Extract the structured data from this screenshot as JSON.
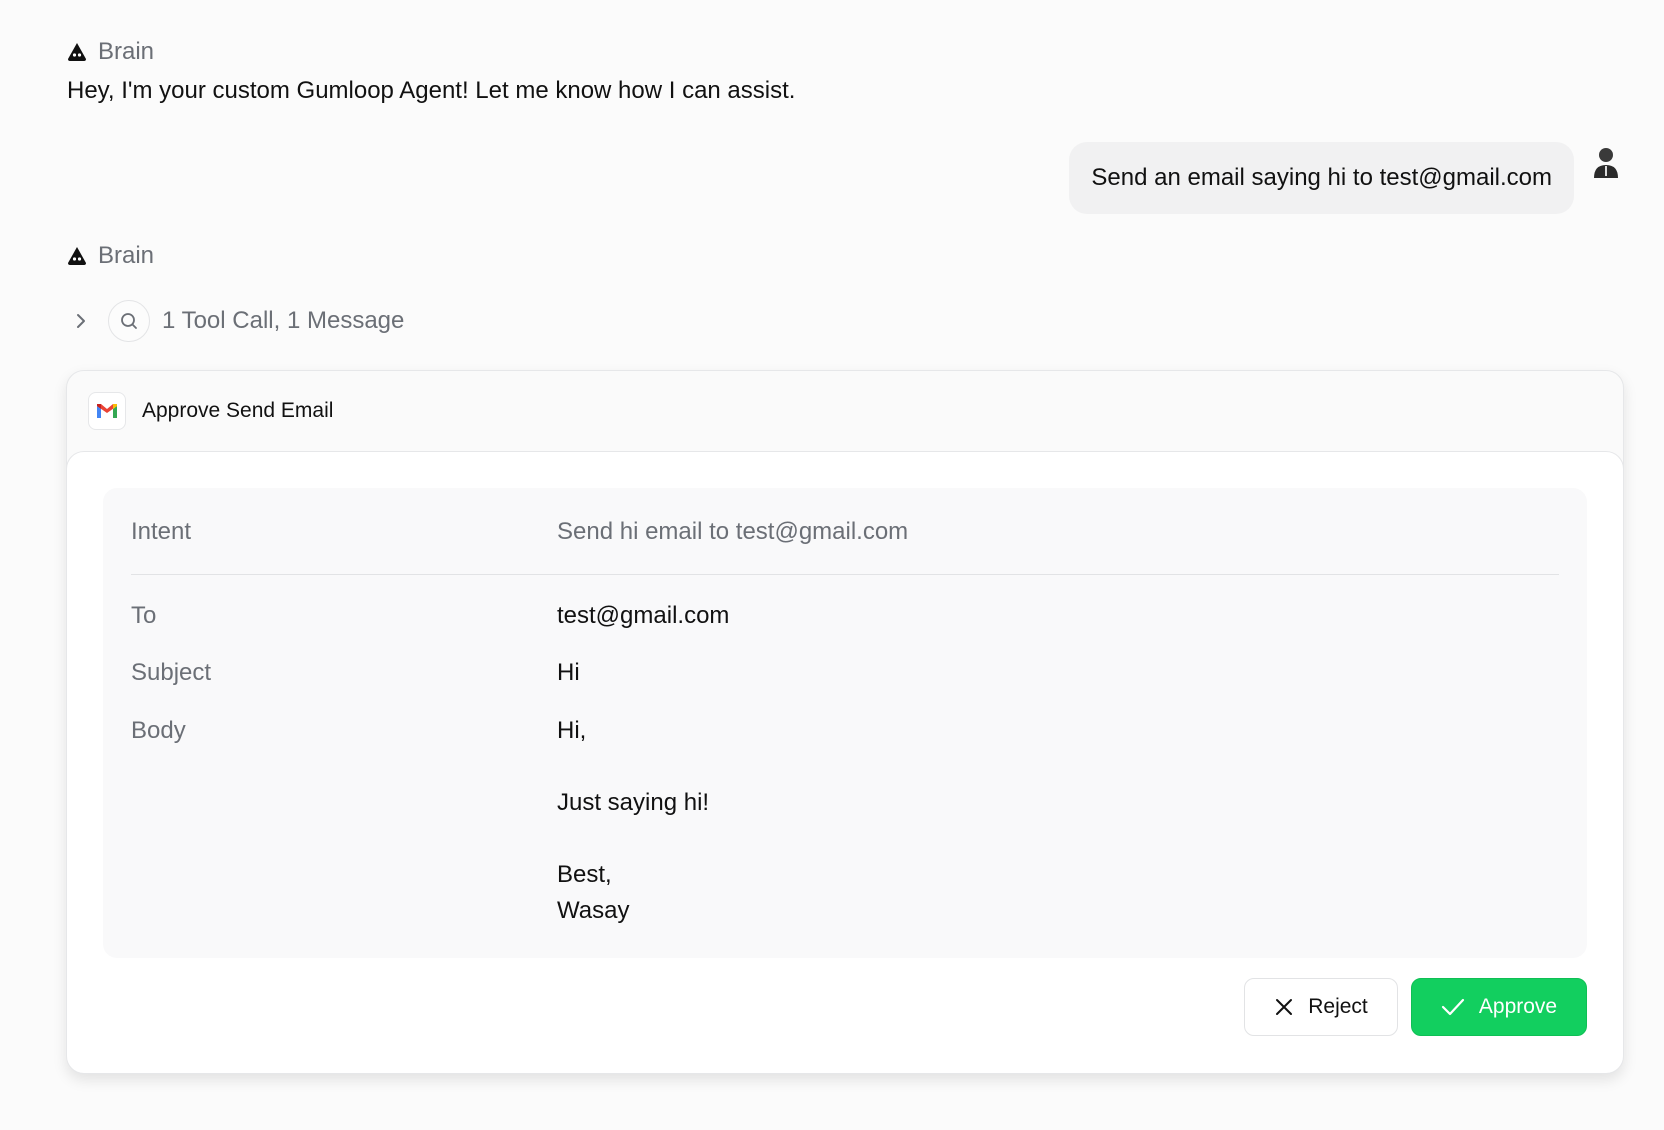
{
  "agent": {
    "name": "Brain",
    "icon": "ghost-icon",
    "greeting": "Hey, I'm your custom Gumloop Agent! Let me know how I can assist."
  },
  "user": {
    "message": "Send an email saying hi to test@gmail.com",
    "avatar_icon": "user-avatar"
  },
  "tool_call": {
    "summary": "1 Tool Call, 1 Message",
    "icon": "search-icon"
  },
  "approval": {
    "title": "Approve Send Email",
    "app_icon": "gmail-icon",
    "intent_label": "Intent",
    "intent_value": "Send hi email to test@gmail.com",
    "to_label": "To",
    "to_value": "test@gmail.com",
    "subject_label": "Subject",
    "subject_value": "Hi",
    "body_label": "Body",
    "body_lines": [
      "Hi,",
      "Just saying hi!",
      "Best,",
      "Wasay"
    ],
    "reject_label": "Reject",
    "approve_label": "Approve"
  },
  "colors": {
    "approve_green": "#12cf5f",
    "muted_text": "#6b6f76",
    "background": "#fbfbfb"
  }
}
